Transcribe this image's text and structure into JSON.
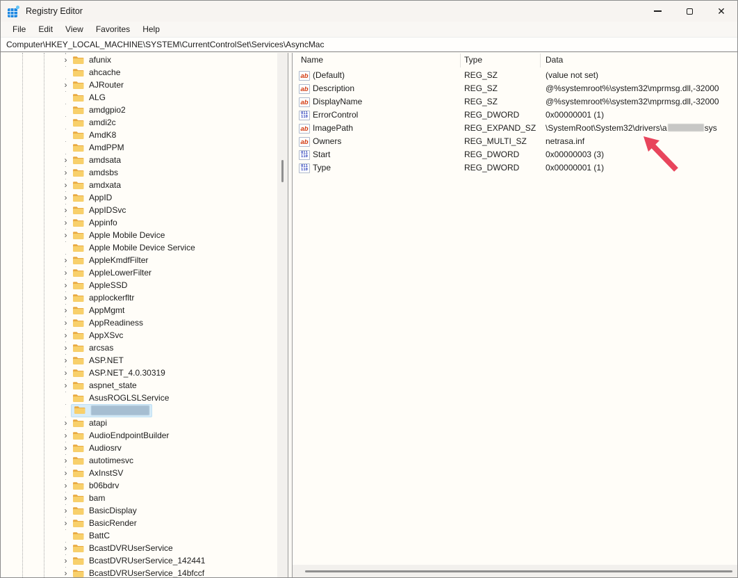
{
  "window": {
    "title": "Registry Editor"
  },
  "titlebar": {
    "controls": [
      {
        "name": "minimize-button",
        "glyph": "minimize"
      },
      {
        "name": "maximize-button",
        "glyph": "maximize"
      },
      {
        "name": "close-button",
        "glyph": "close",
        "label": "✕"
      }
    ]
  },
  "menubar": {
    "items": [
      "File",
      "Edit",
      "View",
      "Favorites",
      "Help"
    ]
  },
  "addressbar": {
    "path": "Computer\\HKEY_LOCAL_MACHINE\\SYSTEM\\CurrentControlSet\\Services\\AsyncMac"
  },
  "tree": {
    "items": [
      {
        "label": "afunix",
        "expandable": true
      },
      {
        "label": "ahcache",
        "expandable": false
      },
      {
        "label": "AJRouter",
        "expandable": true
      },
      {
        "label": "ALG",
        "expandable": false
      },
      {
        "label": "amdgpio2",
        "expandable": false
      },
      {
        "label": "amdi2c",
        "expandable": false
      },
      {
        "label": "AmdK8",
        "expandable": false
      },
      {
        "label": "AmdPPM",
        "expandable": false
      },
      {
        "label": "amdsata",
        "expandable": true
      },
      {
        "label": "amdsbs",
        "expandable": true
      },
      {
        "label": "amdxata",
        "expandable": true
      },
      {
        "label": "AppID",
        "expandable": true
      },
      {
        "label": "AppIDSvc",
        "expandable": true
      },
      {
        "label": "Appinfo",
        "expandable": true
      },
      {
        "label": "Apple Mobile Device",
        "expandable": true
      },
      {
        "label": "Apple Mobile Device Service",
        "expandable": false
      },
      {
        "label": "AppleKmdfFilter",
        "expandable": true
      },
      {
        "label": "AppleLowerFilter",
        "expandable": true
      },
      {
        "label": "AppleSSD",
        "expandable": true
      },
      {
        "label": "applockerfltr",
        "expandable": true
      },
      {
        "label": "AppMgmt",
        "expandable": true
      },
      {
        "label": "AppReadiness",
        "expandable": true
      },
      {
        "label": "AppXSvc",
        "expandable": true
      },
      {
        "label": "arcsas",
        "expandable": true
      },
      {
        "label": "ASP.NET",
        "expandable": true
      },
      {
        "label": "ASP.NET_4.0.30319",
        "expandable": true
      },
      {
        "label": "aspnet_state",
        "expandable": true
      },
      {
        "label": "AsusROGLSLService",
        "expandable": false
      },
      {
        "label": "",
        "expandable": false,
        "selected": true,
        "redacted": true
      },
      {
        "label": "atapi",
        "expandable": true
      },
      {
        "label": "AudioEndpointBuilder",
        "expandable": true
      },
      {
        "label": "Audiosrv",
        "expandable": true
      },
      {
        "label": "autotimesvc",
        "expandable": true
      },
      {
        "label": "AxInstSV",
        "expandable": true
      },
      {
        "label": "b06bdrv",
        "expandable": true
      },
      {
        "label": "bam",
        "expandable": true
      },
      {
        "label": "BasicDisplay",
        "expandable": true
      },
      {
        "label": "BasicRender",
        "expandable": true
      },
      {
        "label": "BattC",
        "expandable": false
      },
      {
        "label": "BcastDVRUserService",
        "expandable": true
      },
      {
        "label": "BcastDVRUserService_142441",
        "expandable": true
      },
      {
        "label": "BcastDVRUserService_14bfccf",
        "expandable": true
      }
    ]
  },
  "list": {
    "columns": [
      "Name",
      "Type",
      "Data"
    ],
    "rows": [
      {
        "name": "(Default)",
        "icon": "string-value-icon",
        "type": "REG_SZ",
        "data": "(value not set)"
      },
      {
        "name": "Description",
        "icon": "string-value-icon",
        "type": "REG_SZ",
        "data": "@%systemroot%\\system32\\mprmsg.dll,-32000"
      },
      {
        "name": "DisplayName",
        "icon": "string-value-icon",
        "type": "REG_SZ",
        "data": "@%systemroot%\\system32\\mprmsg.dll,-32000"
      },
      {
        "name": "ErrorControl",
        "icon": "dword-value-icon",
        "type": "REG_DWORD",
        "data": "0x00000001 (1)"
      },
      {
        "name": "ImagePath",
        "icon": "string-value-icon",
        "type": "REG_EXPAND_SZ",
        "data_prefix": "\\SystemRoot\\System32\\drivers\\a",
        "data_redacted": true,
        "data_suffix": "sys"
      },
      {
        "name": "Owners",
        "icon": "string-value-icon",
        "type": "REG_MULTI_SZ",
        "data": "netrasa.inf"
      },
      {
        "name": "Start",
        "icon": "dword-value-icon",
        "type": "REG_DWORD",
        "data": "0x00000003 (3)"
      },
      {
        "name": "Type",
        "icon": "dword-value-icon",
        "type": "REG_DWORD",
        "data": "0x00000001 (1)"
      }
    ]
  },
  "icons": {
    "string_value_glyph": "ab",
    "dword_value_top": "011",
    "dword_value_bottom": "110",
    "chevron_glyph": "›"
  },
  "colors": {
    "annotation_arrow": "#e8455c",
    "selection_fill": "#d7ecf9",
    "selection_border": "#bfdff3",
    "redaction_fill": "#a6bed1",
    "folder_back": "#e9a941",
    "folder_front": "#f8d06b",
    "string_icon_text": "#d23a10",
    "dword_icon_text": "#2b3fbb"
  }
}
